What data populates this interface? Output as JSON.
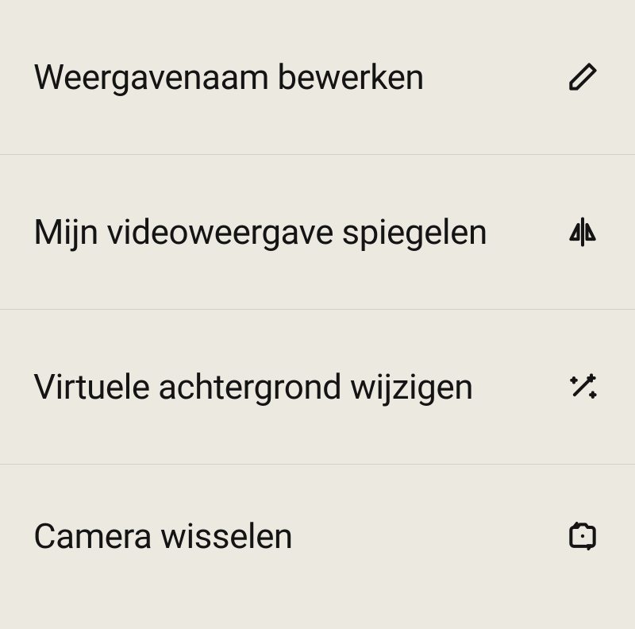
{
  "menu": {
    "items": [
      {
        "label": "Weergavenaam bewerken",
        "icon": "pencil-icon"
      },
      {
        "label": "Mijn videoweergave spiegelen",
        "icon": "mirror-icon"
      },
      {
        "label": "Virtuele achtergrond wijzigen",
        "icon": "magic-wand-icon"
      },
      {
        "label": "Camera wisselen",
        "icon": "camera-flip-icon"
      }
    ]
  }
}
